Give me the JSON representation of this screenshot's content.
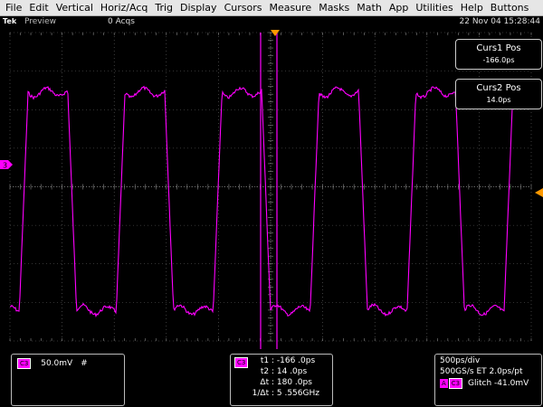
{
  "menu": [
    "File",
    "Edit",
    "Vertical",
    "Horiz/Acq",
    "Trig",
    "Display",
    "Cursors",
    "Measure",
    "Masks",
    "Math",
    "App",
    "Utilities",
    "Help",
    "Buttons"
  ],
  "status": {
    "brand": "Tek",
    "mode": "Preview",
    "acqs": "0 Acqs",
    "datetime": "22 Nov 04 15:28:44"
  },
  "channel_marker": "3",
  "curs1": {
    "title": "Curs1 Pos",
    "value": "-166.0ps"
  },
  "curs2": {
    "title": "Curs2 Pos",
    "value": "14.0ps"
  },
  "channel_panel": {
    "channel": "C3",
    "scale": "50.0mV",
    "bw_symbol": "#"
  },
  "cursor_panel": {
    "channel": "C3",
    "t1_label": "t1 :",
    "t1_value": "-166 .0ps",
    "t2_label": "t2 :",
    "t2_value": "14 .0ps",
    "dt_label": "Δt :",
    "dt_value": "180 .0ps",
    "inv_label": "1/Δt :",
    "inv_value": "5 .556GHz"
  },
  "horiz_panel": {
    "timebase": "500ps/div",
    "sample": "500GS/s ET 2.0ps/pt",
    "trig_a": "A",
    "trig_ch": "C3",
    "trig_text": "Glitch  -41.0mV"
  },
  "colors": {
    "trace": "#ff00ff",
    "cursor": "#ff00ff",
    "grid": "#666666",
    "trigger": "#ff9900"
  },
  "chart_data": {
    "type": "line",
    "title": "",
    "xlabel": "",
    "ylabel": "",
    "x_divisions": 10,
    "y_divisions": 8,
    "series": [
      {
        "name": "",
        "waveform": "square",
        "high_level_div": 2.45,
        "low_level_div": -3.2,
        "period_div": 1.86,
        "first_rising_edge_div": 0.18
      }
    ],
    "cursors": [
      {
        "label": "t1",
        "value": "-166.0ps"
      },
      {
        "label": "t2",
        "value": "14.0ps"
      }
    ]
  }
}
